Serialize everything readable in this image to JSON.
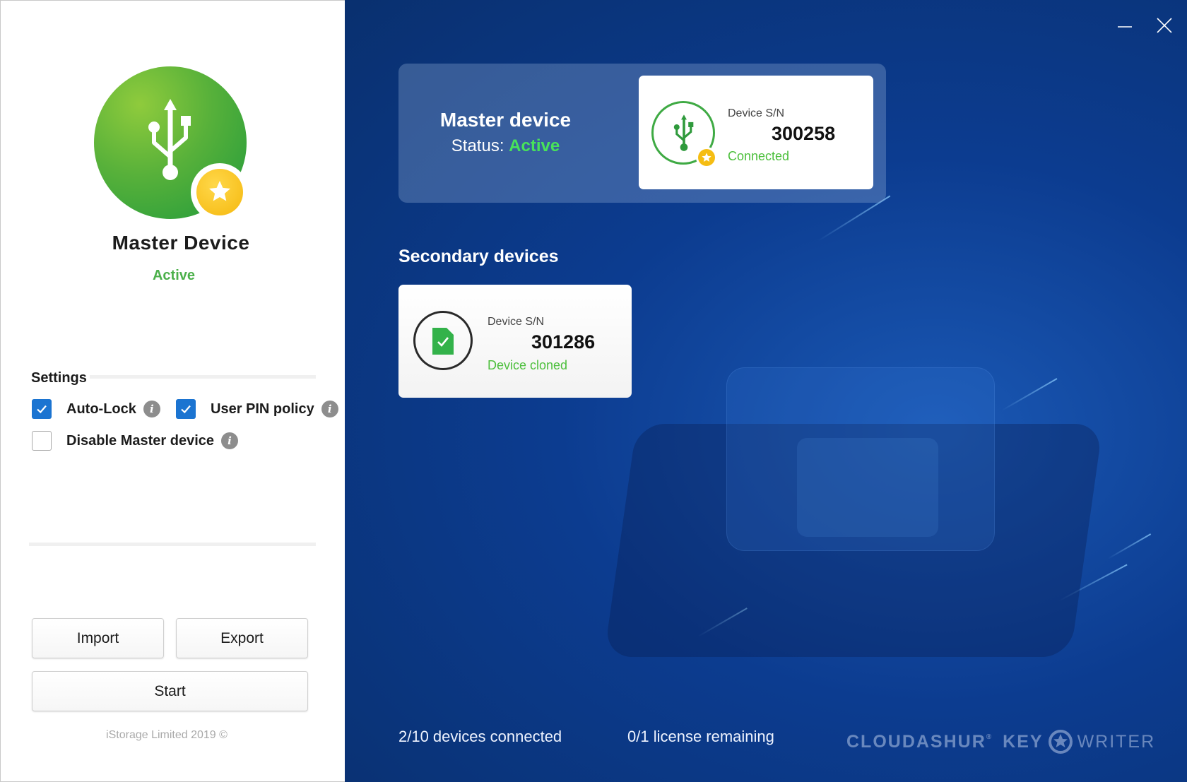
{
  "left": {
    "title": "Master Device",
    "status": "Active",
    "settings": {
      "title": "Settings",
      "auto_lock": {
        "label": "Auto-Lock",
        "checked": true
      },
      "user_pin_policy": {
        "label": "User PIN policy",
        "checked": true
      },
      "disable_master": {
        "label": "Disable Master device",
        "checked": false
      }
    },
    "buttons": {
      "import": "Import",
      "export": "Export",
      "start": "Start"
    },
    "copyright": "iStorage Limited 2019 ©"
  },
  "master_panel": {
    "title": "Master device",
    "status_label": "Status:",
    "status_value": "Active",
    "device": {
      "sn_label": "Device S/N",
      "sn": "300258",
      "state": "Connected"
    }
  },
  "secondary": {
    "title": "Secondary devices",
    "devices": [
      {
        "sn_label": "Device S/N",
        "sn": "301286",
        "state": "Device cloned"
      }
    ]
  },
  "footer": {
    "devices_connected": "2/10 devices connected",
    "license_remaining": "0/1 license remaining",
    "brand_1": "CLOUDASHUR",
    "brand_2": "KEY",
    "brand_3": "WRITER"
  },
  "colors": {
    "accent_blue": "#1b74d1",
    "active_green": "#4bb04a",
    "status_bright_green": "#48e25a",
    "bg_blue": "#0c3c90"
  },
  "icons": [
    "usb-icon",
    "star-icon",
    "info-icon",
    "check-icon",
    "minimize-icon",
    "close-icon",
    "cloned-file-icon"
  ]
}
